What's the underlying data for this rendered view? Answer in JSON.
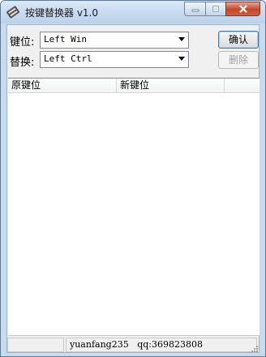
{
  "window": {
    "title": "按键替换器 v1.0",
    "icon": "keyboard-app-icon"
  },
  "form": {
    "key_label": "键位:",
    "key_value": "Left Win",
    "replace_label": "替换:",
    "replace_value": "Left Ctrl",
    "confirm_button": "确认",
    "delete_button": "删除"
  },
  "list": {
    "columns": [
      "原键位",
      "新键位"
    ],
    "rows": []
  },
  "statusbar": {
    "pane1": "",
    "author": "yuanfang235",
    "qq": "qq:369823808"
  },
  "colors": {
    "titlebar": "#c6d9ee",
    "close_button": "#c3462c",
    "client_bg": "#f0f0f0"
  }
}
